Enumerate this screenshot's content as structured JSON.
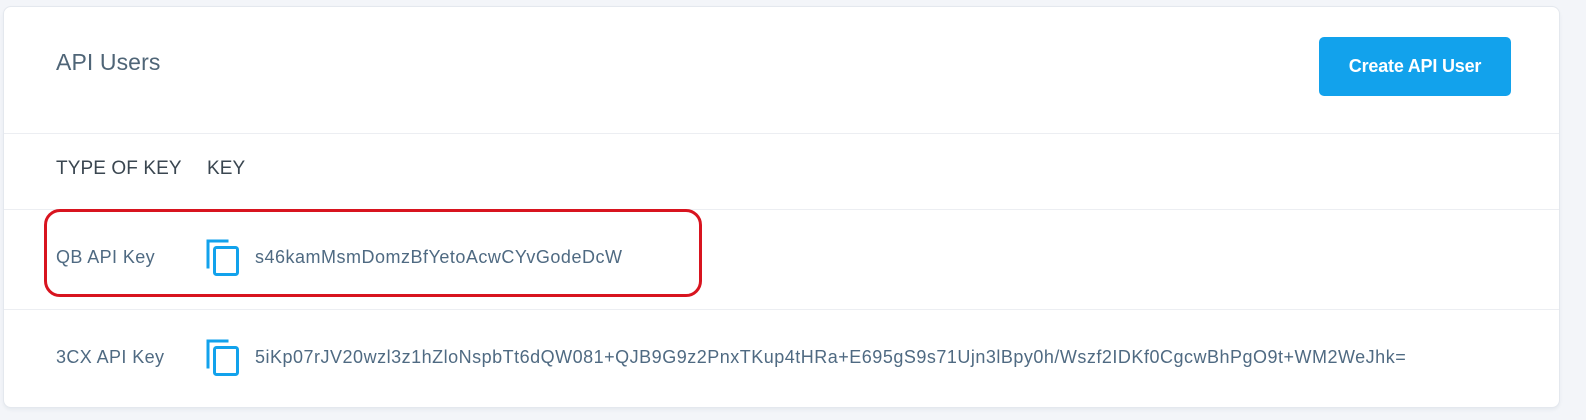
{
  "panel": {
    "title": "API Users",
    "create_button_label": "Create API User"
  },
  "table": {
    "columns": [
      "TYPE OF KEY",
      "KEY"
    ],
    "rows": [
      {
        "type": "QB API Key",
        "key": "s46kamMsmDomzBfYetoAcwCYvGodeDcW",
        "icon": "copy-icon"
      },
      {
        "type": "3CX API Key",
        "key": "5iKp07rJV20wzl3z1hZloNspbTt6dQW081+QJB9G9z2PnxTKup4tHRa+E695gS9s71Ujn3lBpy0h/Wszf2IDKf0CgcwBhPgO9t+WM2WeJhk=",
        "icon": "copy-icon"
      }
    ]
  },
  "colors": {
    "accent": "#12a2ec",
    "highlight": "#d8141f",
    "text_muted": "#4f6a82"
  }
}
